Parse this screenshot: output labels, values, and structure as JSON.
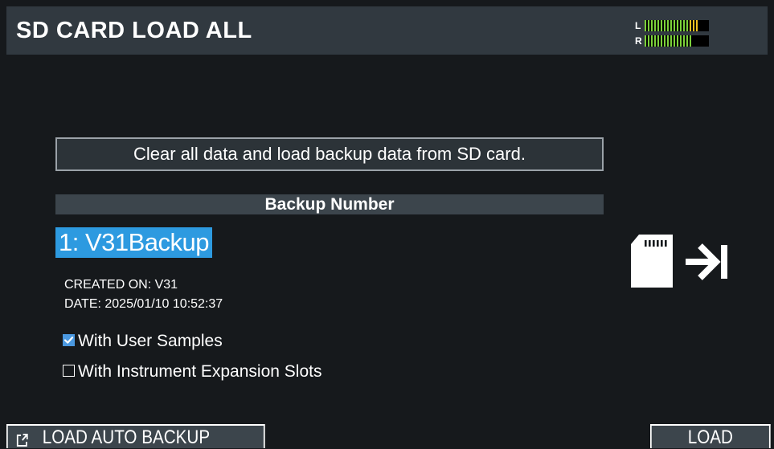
{
  "header": {
    "title": "SD CARD LOAD ALL",
    "meters": {
      "left_label": "L",
      "right_label": "R",
      "left_level": 0.86,
      "right_level": 0.74,
      "left_peak": 0.14,
      "colors": {
        "signal": "#7bd13a",
        "peak": "#f0c020"
      }
    }
  },
  "main": {
    "message": "Clear all data and load backup data from SD card.",
    "backup_number_label": "Backup Number",
    "backup_value": "1: V31Backup",
    "created_on": "CREATED ON: V31",
    "date": "DATE: 2025/01/10 10:52:37",
    "options": [
      {
        "label": "With User Samples",
        "checked": true
      },
      {
        "label": "With Instrument Expansion Slots",
        "checked": false
      }
    ],
    "icons": [
      "sd-card-icon",
      "load-arrow-icon"
    ]
  },
  "function_keys": {
    "left_label": "LOAD AUTO BACKUP",
    "left_icon": "open-window-icon",
    "right_label": "LOAD"
  },
  "colors": {
    "background": "#16191c",
    "header": "#313940",
    "highlight": "#2d9ae0",
    "checkbox": "#4a98e0"
  }
}
